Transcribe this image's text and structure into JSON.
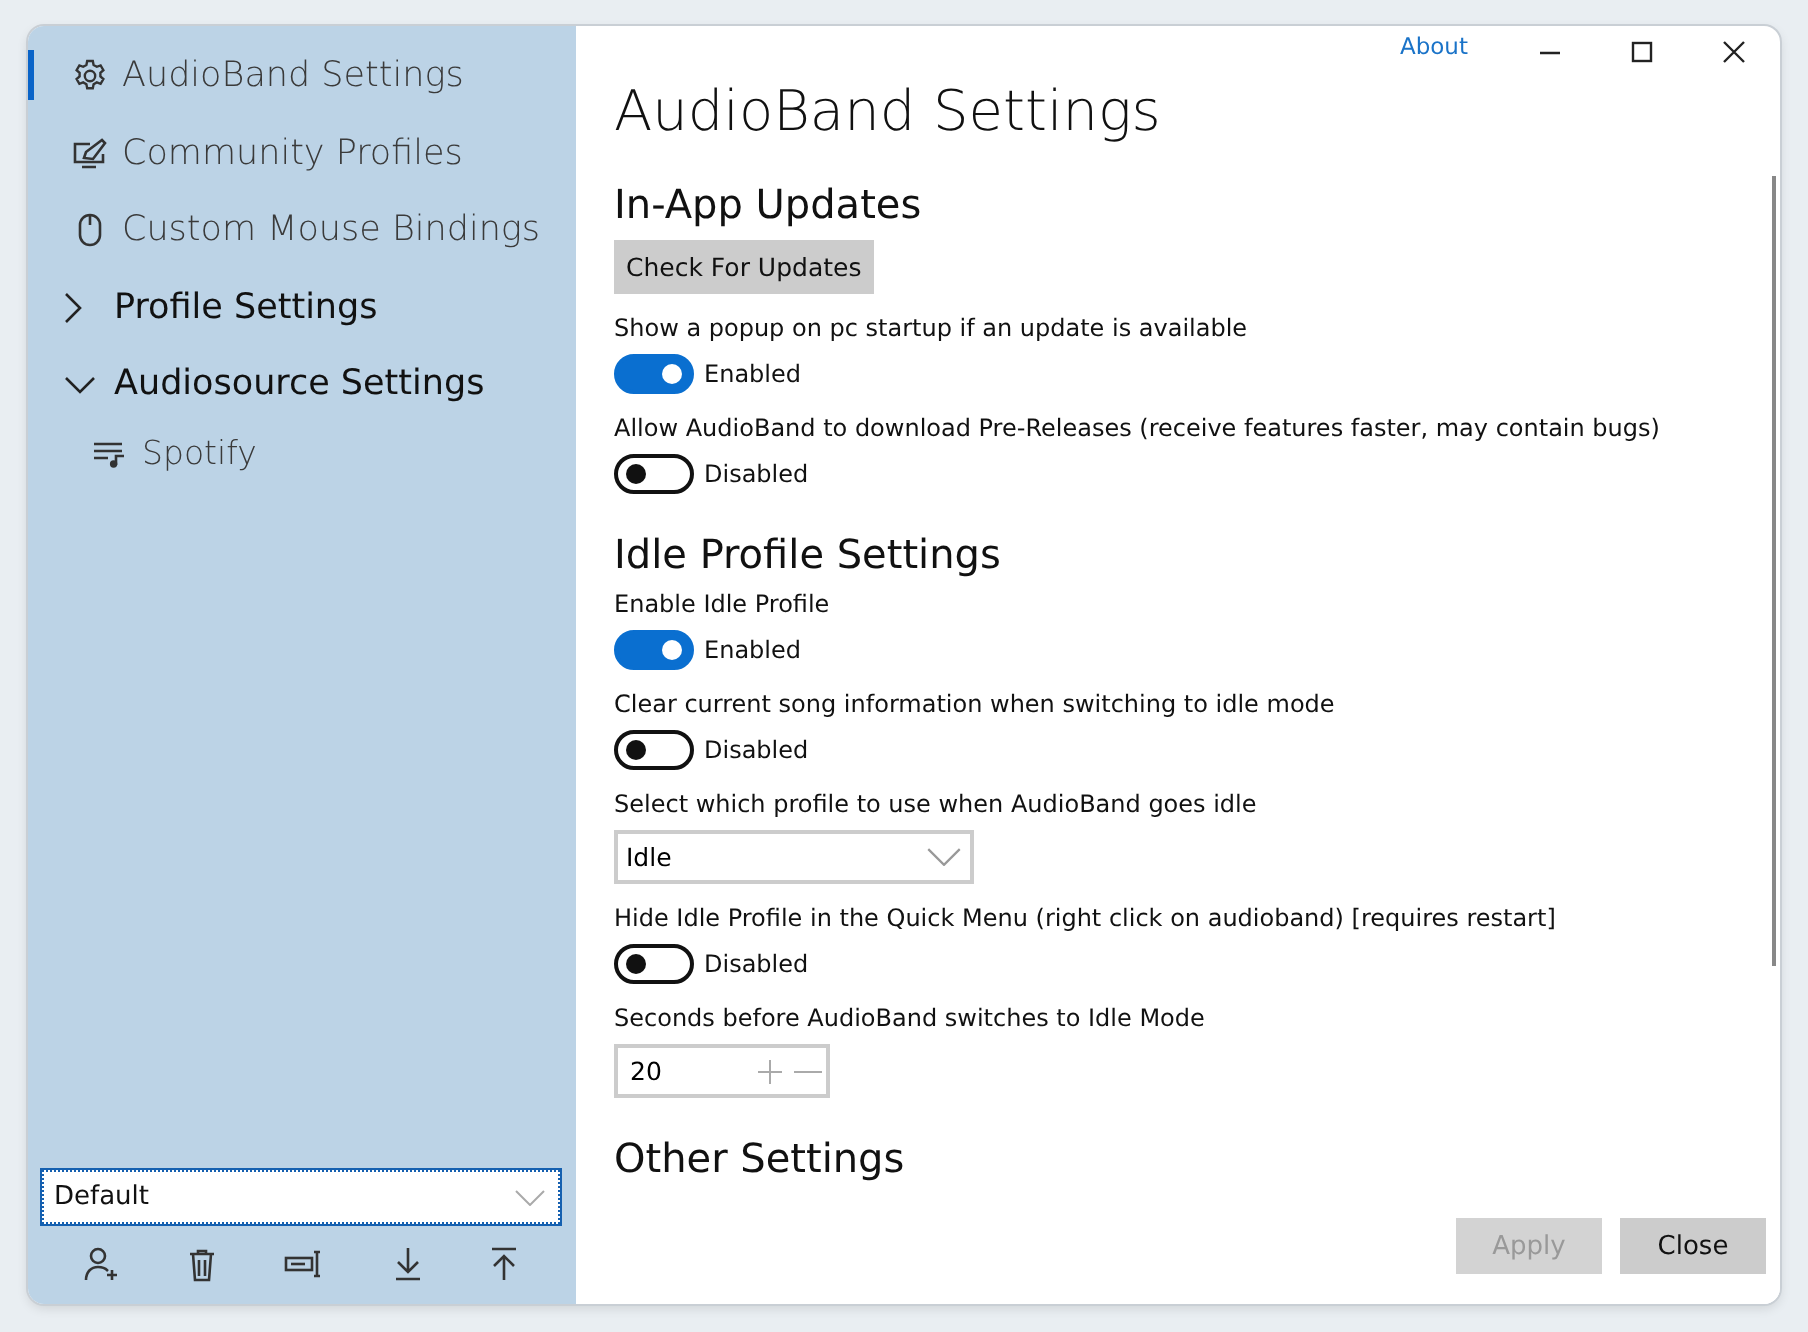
{
  "window": {
    "about_link": "About",
    "controls": [
      {
        "kind": "minimize"
      },
      {
        "kind": "maximize"
      },
      {
        "kind": "close"
      }
    ]
  },
  "sidebar": {
    "items": [
      {
        "kind": "page",
        "label": "AudioBand Settings",
        "selected": true
      },
      {
        "kind": "page",
        "label": "Community Profiles",
        "selected": false
      },
      {
        "kind": "page",
        "label": "Custom Mouse Bindings",
        "selected": false
      },
      {
        "kind": "group",
        "label": "Profile Settings",
        "selected": false,
        "expanded": false
      },
      {
        "kind": "group",
        "label": "Audiosource Settings",
        "selected": false,
        "expanded": true,
        "children": [
          {
            "kind": "page",
            "label": "Spotify",
            "selected": false
          }
        ]
      }
    ],
    "profile_dropdown": {
      "value": "Default"
    },
    "toolbar": [
      {
        "kind": "add-user"
      },
      {
        "kind": "delete"
      },
      {
        "kind": "rename"
      },
      {
        "kind": "import"
      },
      {
        "kind": "export"
      }
    ]
  },
  "page": {
    "title": "AudioBand Settings",
    "sections": [
      {
        "heading": "In-App Updates",
        "settings": [
          {
            "kind": "button",
            "label": "Check For Updates"
          },
          {
            "kind": "toggle",
            "label": "Show a popup on pc startup if an update is available",
            "on": true,
            "state_text": "Enabled"
          },
          {
            "kind": "toggle",
            "label": "Allow AudioBand to download Pre-Releases (receive features faster, may contain bugs)",
            "on": false,
            "state_text": "Disabled"
          }
        ]
      },
      {
        "heading": "Idle Profile Settings",
        "settings": [
          {
            "kind": "toggle",
            "label": "Enable Idle Profile",
            "on": true,
            "state_text": "Enabled"
          },
          {
            "kind": "toggle",
            "label": "Clear current song information when switching to idle mode",
            "on": false,
            "state_text": "Disabled"
          },
          {
            "kind": "dropdown",
            "label": "Select which profile to use when AudioBand goes idle",
            "value": "Idle"
          },
          {
            "kind": "toggle",
            "label": "Hide Idle Profile in the Quick Menu (right click on audioband) [requires restart]",
            "on": false,
            "state_text": "Disabled"
          },
          {
            "kind": "number",
            "label": "Seconds before AudioBand switches to Idle Mode",
            "value": "20"
          }
        ]
      },
      {
        "heading": "Other Settings"
      }
    ]
  },
  "footer": {
    "buttons": [
      {
        "label": "Apply",
        "disabled": true
      },
      {
        "label": "Close",
        "disabled": false
      }
    ]
  }
}
